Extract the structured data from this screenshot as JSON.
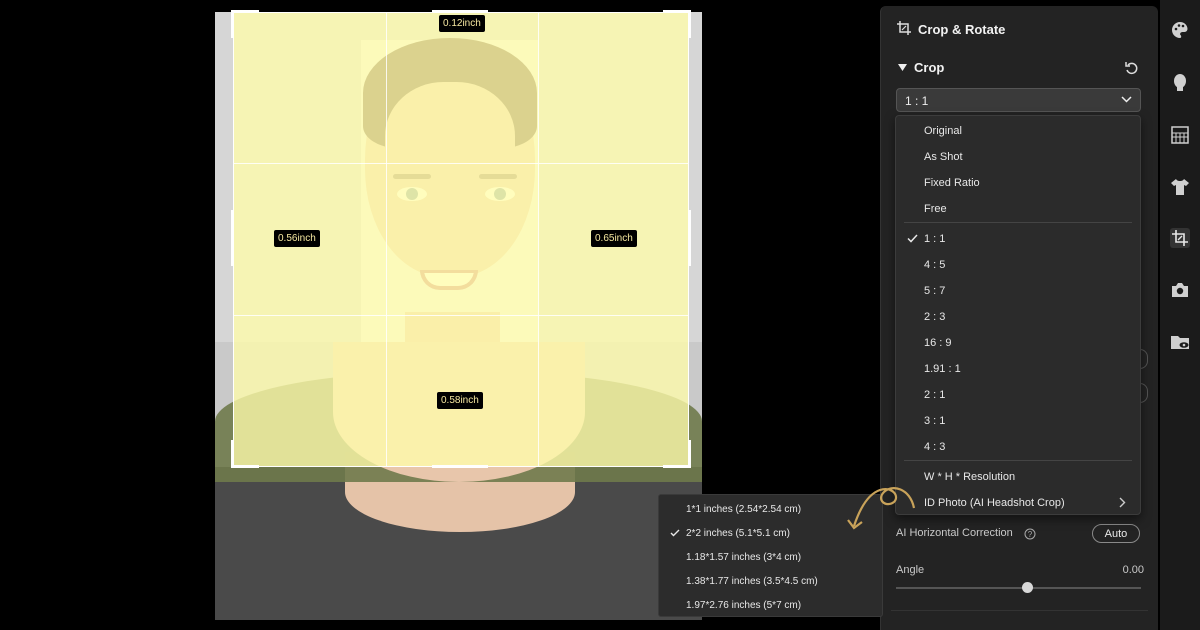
{
  "panel": {
    "title": "Crop & Rotate",
    "crop_heading": "Crop",
    "ratio_select_value": "1 : 1",
    "ai_horizontal_label": "AI Horizontal Correction",
    "auto_button": "Auto",
    "angle_label": "Angle",
    "angle_value": "0.00"
  },
  "dropdown": {
    "items": [
      {
        "label": "Original"
      },
      {
        "label": "As Shot"
      },
      {
        "label": "Fixed Ratio"
      },
      {
        "label": "Free"
      },
      {
        "label": "1 : 1",
        "selected": true
      },
      {
        "label": "4 : 5"
      },
      {
        "label": "5 : 7"
      },
      {
        "label": "2 : 3"
      },
      {
        "label": "16 : 9"
      },
      {
        "label": "1.91 : 1"
      },
      {
        "label": "2 : 1"
      },
      {
        "label": "3 : 1"
      },
      {
        "label": "4 : 3"
      },
      {
        "label": "W * H * Resolution"
      },
      {
        "label": "ID Photo  (AI Headshot Crop)",
        "has_submenu": true
      }
    ]
  },
  "submenu": {
    "items": [
      {
        "label": "1*1 inches (2.54*2.54 cm)"
      },
      {
        "label": "2*2 inches (5.1*5.1 cm)",
        "selected": true
      },
      {
        "label": "1.18*1.57 inches (3*4 cm)"
      },
      {
        "label": "1.38*1.77 inches (3.5*4.5 cm)"
      },
      {
        "label": "1.97*2.76 inches (5*7 cm)"
      }
    ]
  },
  "measurements": {
    "top": "0.12inch",
    "left": "0.56inch",
    "right": "0.65inch",
    "bottom": "0.58inch"
  },
  "colors": {
    "crop_overlay": "#fffcaa",
    "panel_bg": "#232323",
    "dropdown_bg": "#2b2b2b",
    "annotation_arrow": "#c9a35a"
  },
  "sidebar_icons": [
    "palette-icon",
    "face-icon",
    "texture-icon",
    "shirt-icon",
    "crop-icon",
    "camera-icon",
    "folder-eye-icon"
  ]
}
